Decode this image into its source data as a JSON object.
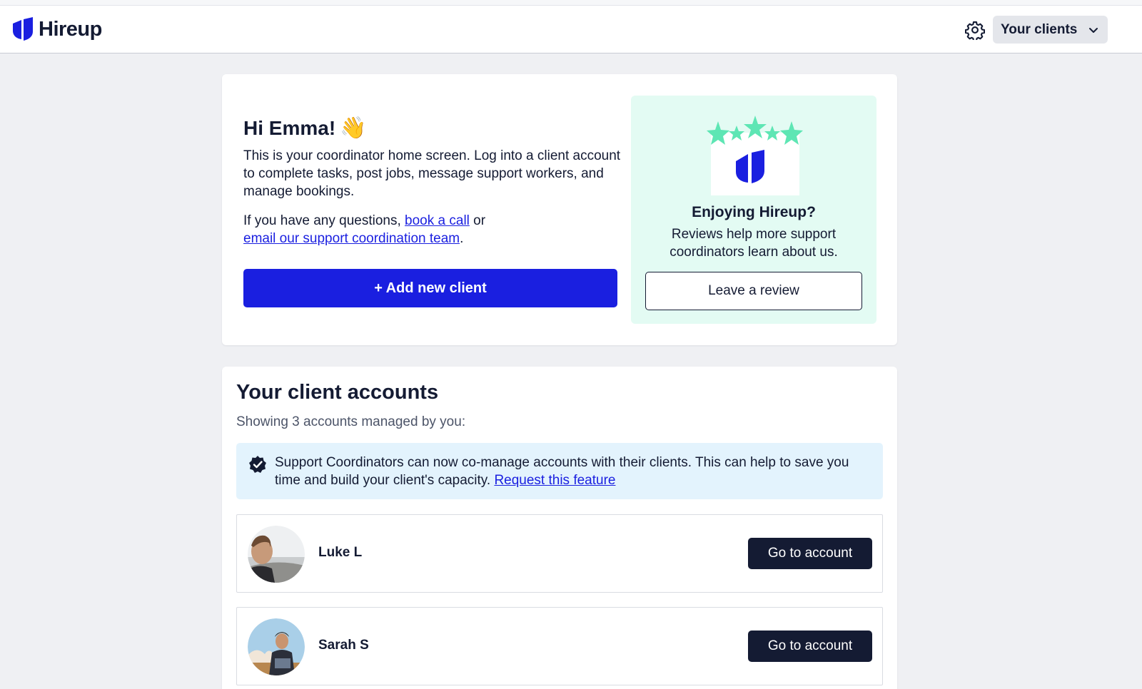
{
  "header": {
    "brand": "Hireup",
    "logo_icon": "hireup-shield-logo",
    "settings_icon": "gear-icon",
    "clients_menu_label": "Your clients",
    "clients_menu_icon": "chevron-down-icon"
  },
  "welcome": {
    "greeting": "Hi Emma!",
    "greeting_emoji": "👋",
    "intro": "This is your coordinator home screen. Log into a client account to complete tasks, post jobs, message support workers, and manage bookings.",
    "questions_prefix": "If you have any questions,",
    "book_call_link": "book a call",
    "questions_or": "or",
    "email_link": "email our support coordination team",
    "questions_suffix": ".",
    "add_client_button": "+ Add new client"
  },
  "promo": {
    "title": "Enjoying Hireup?",
    "text": "Reviews help more support coordinators learn about us.",
    "button": "Leave a review",
    "illustration": "stars-over-hireup-logo"
  },
  "accounts": {
    "title": "Your client accounts",
    "subtitle": "Showing 3 accounts managed by you:",
    "notice": {
      "icon": "verified-badge-icon",
      "text": "Support Coordinators can now co-manage accounts with their clients. This can help to save you time and build your client's capacity.",
      "link": "Request this feature"
    },
    "clients": [
      {
        "name": "Luke L",
        "button": "Go to account"
      },
      {
        "name": "Sarah S",
        "button": "Go to account"
      }
    ]
  },
  "colors": {
    "primary": "#1a1fe0",
    "navy": "#141b33",
    "promo_bg": "#e3fbf3",
    "notice_bg": "#e3f3fd",
    "page_bg": "#eff0f3",
    "star_green": "#5ee6b4"
  }
}
